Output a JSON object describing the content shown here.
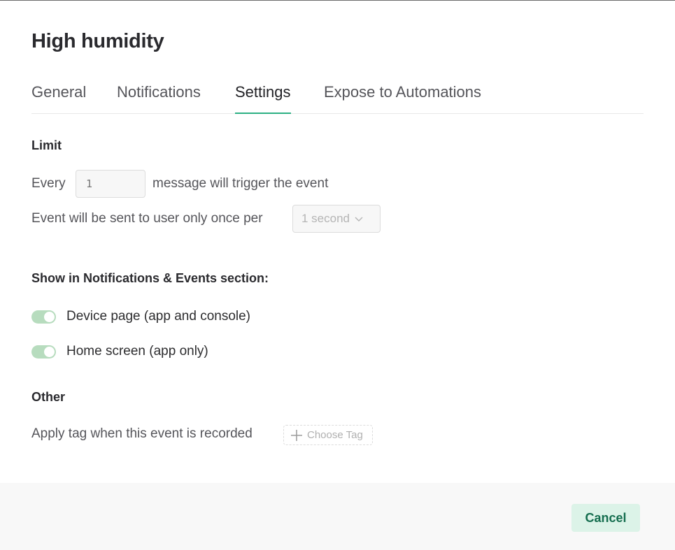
{
  "dialog": {
    "title": "High humidity"
  },
  "tabs": [
    {
      "label": "General"
    },
    {
      "label": "Notifications"
    },
    {
      "label": "Settings",
      "active": true
    },
    {
      "label": "Expose to Automations"
    }
  ],
  "limit": {
    "title": "Limit",
    "every_prefix": "Every",
    "every_input_placeholder": "1",
    "every_suffix": "message will trigger the event",
    "once_per_text": "Event will be sent to user only once per",
    "once_per_selected": "1 second"
  },
  "show_in": {
    "title": "Show in Notifications & Events section:",
    "toggles": [
      {
        "label": "Device page (app and console)",
        "on": true
      },
      {
        "label": "Home screen (app only)",
        "on": true
      }
    ]
  },
  "other": {
    "title": "Other",
    "apply_tag_text": "Apply tag when this event is recorded",
    "choose_tag_label": "Choose Tag"
  },
  "footer": {
    "cancel_label": "Cancel"
  },
  "colors": {
    "accent": "#2bb083",
    "toggle_on": "#b7dcbe",
    "cancel_bg": "#dcf3e8",
    "cancel_text": "#156e4f"
  }
}
